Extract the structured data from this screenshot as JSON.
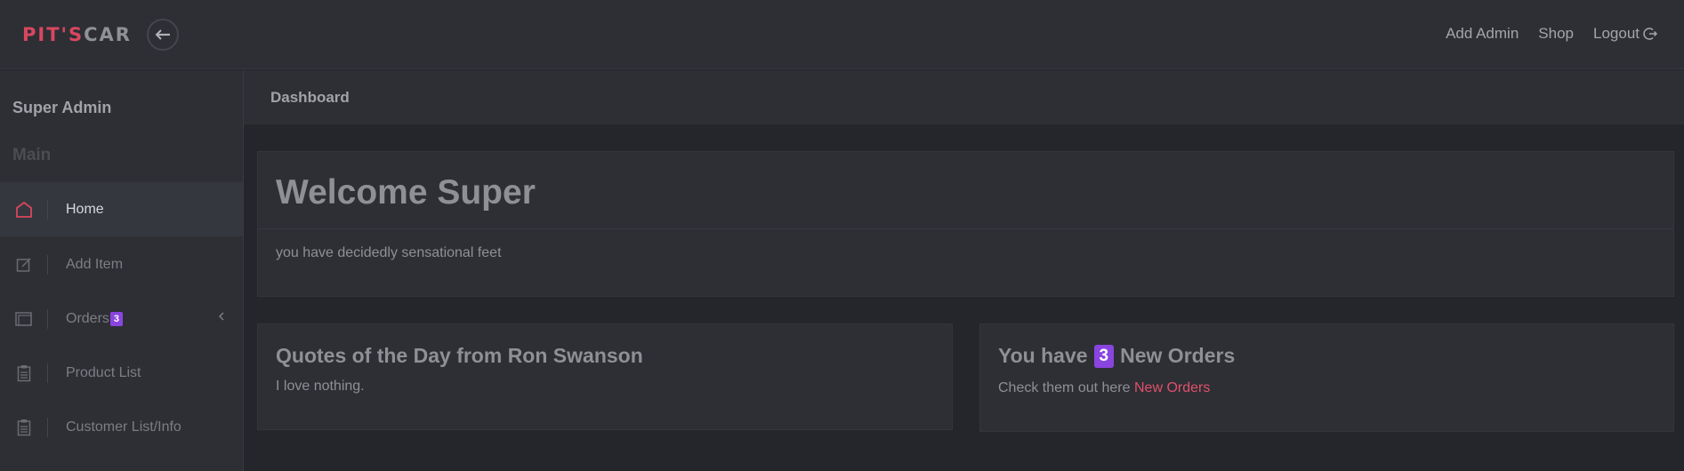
{
  "brand": {
    "part1": "PIT'S",
    "part2": "CAR",
    "accent": "#d9475f"
  },
  "topnav": {
    "add_admin": "Add Admin",
    "shop": "Shop",
    "logout": "Logout"
  },
  "sidebar": {
    "user": "Super Admin",
    "section": "Main",
    "items": [
      {
        "label": "Home",
        "icon": "home-icon",
        "active": true
      },
      {
        "label": "Add Item",
        "icon": "edit-icon"
      },
      {
        "label": "Orders",
        "icon": "orders-icon",
        "badge": "3"
      },
      {
        "label": "Product List",
        "icon": "clipboard-icon"
      },
      {
        "label": "Customer List/Info",
        "icon": "clipboard-icon"
      }
    ]
  },
  "breadcrumb": "Dashboard",
  "welcome": {
    "title": "Welcome Super",
    "subtitle": "you have decidedly sensational feet"
  },
  "quote_card": {
    "title": "Quotes of the Day from Ron Swanson",
    "quote": "I love nothing."
  },
  "orders_card": {
    "title_pre": "You have",
    "count": "3",
    "title_post": "New Orders",
    "body": "Check them out here",
    "link": "New Orders"
  },
  "colors": {
    "badge": "#8a44e0",
    "link": "#e0506a",
    "bg": "#24262b",
    "panel": "#2d2f35"
  }
}
